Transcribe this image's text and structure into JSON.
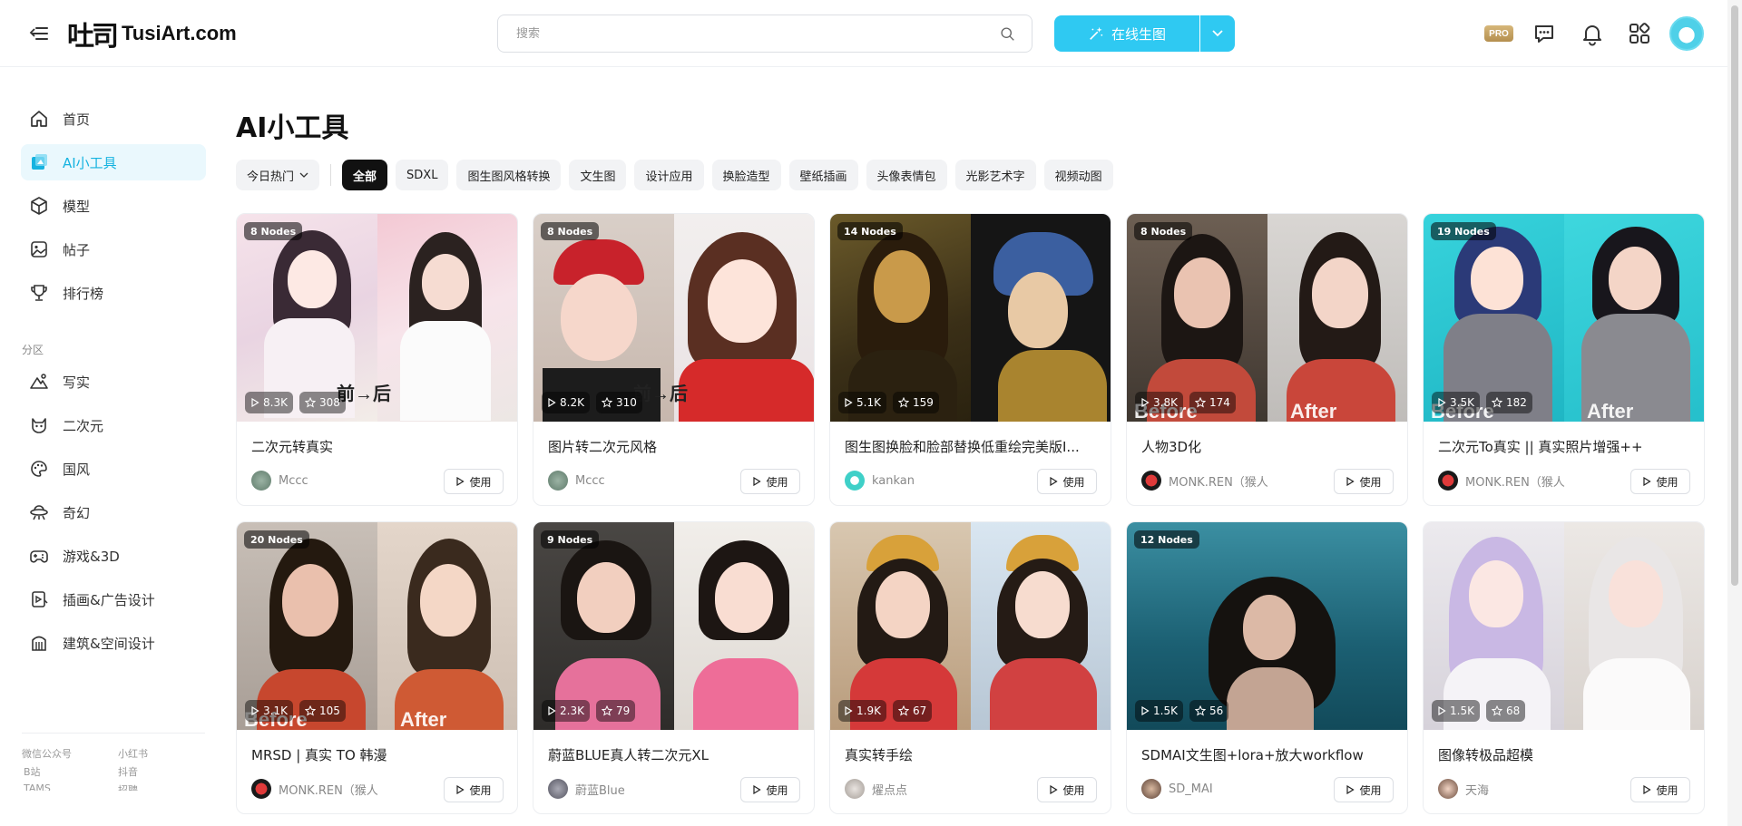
{
  "header": {
    "logo_mark": "吐司",
    "logo_text": "TusiArt.com",
    "search_placeholder": "搜索",
    "generate_label": "在线生图",
    "pro_badge": "PRO"
  },
  "sidebar": {
    "items": [
      {
        "label": "首页",
        "icon": "home-icon"
      },
      {
        "label": "AI小工具",
        "icon": "tools-icon",
        "active": true
      },
      {
        "label": "模型",
        "icon": "cube-icon"
      },
      {
        "label": "帖子",
        "icon": "image-icon"
      },
      {
        "label": "排行榜",
        "icon": "trophy-icon"
      }
    ],
    "section_label": "分区",
    "sections": [
      {
        "label": "写实",
        "icon": "landscape-icon"
      },
      {
        "label": "二次元",
        "icon": "cat-icon"
      },
      {
        "label": "国风",
        "icon": "palette-icon"
      },
      {
        "label": "奇幻",
        "icon": "ufo-icon"
      },
      {
        "label": "游戏&3D",
        "icon": "gamepad-icon"
      },
      {
        "label": "插画&广告设计",
        "icon": "design-icon"
      },
      {
        "label": "建筑&空间设计",
        "icon": "building-icon"
      }
    ],
    "footer_links": [
      "微信公众号",
      "小红书",
      "B站",
      "抖音",
      "TAMS",
      "招聘"
    ]
  },
  "main": {
    "title": "AI小工具",
    "sort_label": "今日热门",
    "filters": [
      "全部",
      "SDXL",
      "图生图风格转换",
      "文生图",
      "设计应用",
      "换脸造型",
      "壁纸插画",
      "头像表情包",
      "光影艺术字",
      "视频动图"
    ],
    "active_filter": "全部",
    "use_label": "使用",
    "cards": [
      {
        "nodes": "8 Nodes",
        "runs": "8.3K",
        "stars": "308",
        "title": "二次元转真实",
        "author": "Mccc",
        "overlay": "前→后"
      },
      {
        "nodes": "8 Nodes",
        "runs": "8.2K",
        "stars": "310",
        "title": "图片转二次元风格",
        "author": "Mccc",
        "overlay": "前→后"
      },
      {
        "nodes": "14 Nodes",
        "runs": "5.1K",
        "stars": "159",
        "title": "图生图换脸和脸部替换低重绘完美版I...",
        "author": "kankan",
        "overlay": ""
      },
      {
        "nodes": "8 Nodes",
        "runs": "3.8K",
        "stars": "174",
        "title": "人物3D化",
        "author": "MONK.REN（猴人",
        "overlay": "Before After"
      },
      {
        "nodes": "19 Nodes",
        "runs": "3.5K",
        "stars": "182",
        "title": "二次元To真实 || 真实照片增强++",
        "author": "MONK.REN（猴人",
        "overlay": "Before After"
      },
      {
        "nodes": "20 Nodes",
        "runs": "3.1K",
        "stars": "105",
        "title": "MRSD | 真实 TO 韩漫",
        "author": "MONK.REN（猴人",
        "overlay": "Before After"
      },
      {
        "nodes": "9 Nodes",
        "runs": "2.3K",
        "stars": "79",
        "title": "蔚蓝BLUE真人转二次元XL",
        "author": "蔚蓝Blue",
        "overlay": ""
      },
      {
        "nodes": "",
        "runs": "1.9K",
        "stars": "67",
        "title": "真实转手绘",
        "author": "燿点点",
        "overlay": ""
      },
      {
        "nodes": "12 Nodes",
        "runs": "1.5K",
        "stars": "56",
        "title": "SDMAI文生图+lora+放大workflow",
        "author": "SD_MAI",
        "overlay": ""
      },
      {
        "nodes": "",
        "runs": "1.5K",
        "stars": "68",
        "title": "图像转极品超模",
        "author": "天海",
        "overlay": ""
      }
    ]
  },
  "colors": {
    "accent": "#2fc9f2",
    "active_bg": "#eaf8fd",
    "active_text": "#16b3e0",
    "chip_active": "#111111"
  }
}
